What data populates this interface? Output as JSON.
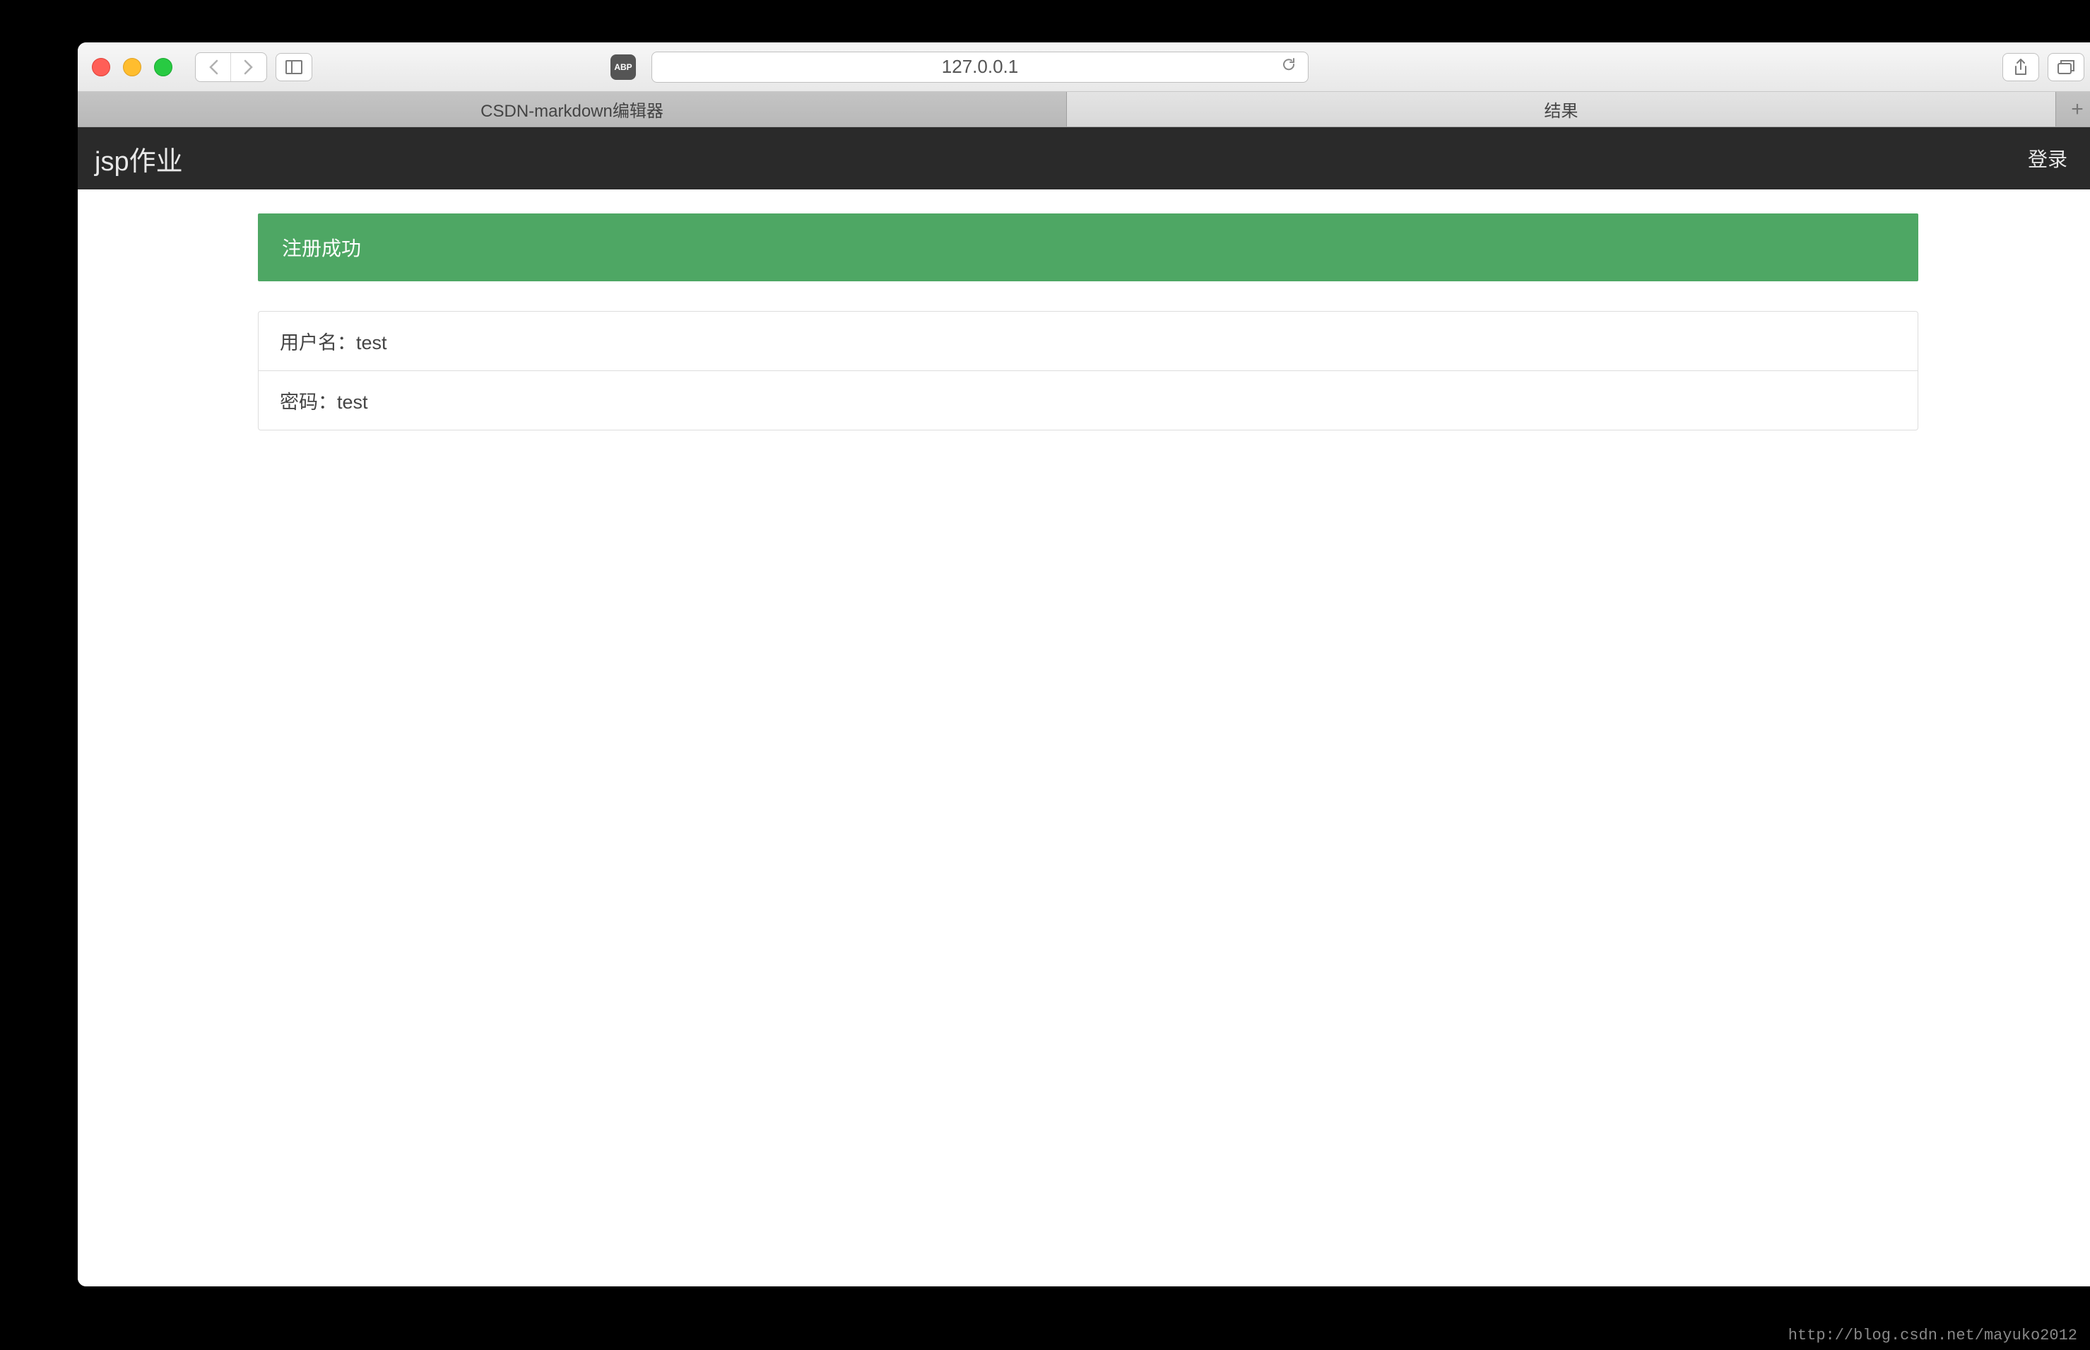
{
  "browser": {
    "url": "127.0.0.1",
    "abp_label": "ABP",
    "tabs": [
      {
        "label": "CSDN-markdown编辑器",
        "active": false
      },
      {
        "label": "结果",
        "active": true
      }
    ]
  },
  "navbar": {
    "brand": "jsp作业",
    "login_link": "登录"
  },
  "alert": {
    "message": "注册成功"
  },
  "result": {
    "username_label": "用户名：",
    "username_value": "test",
    "password_label": "密码：",
    "password_value": "test"
  },
  "watermark": "http://blog.csdn.net/mayuko2012"
}
